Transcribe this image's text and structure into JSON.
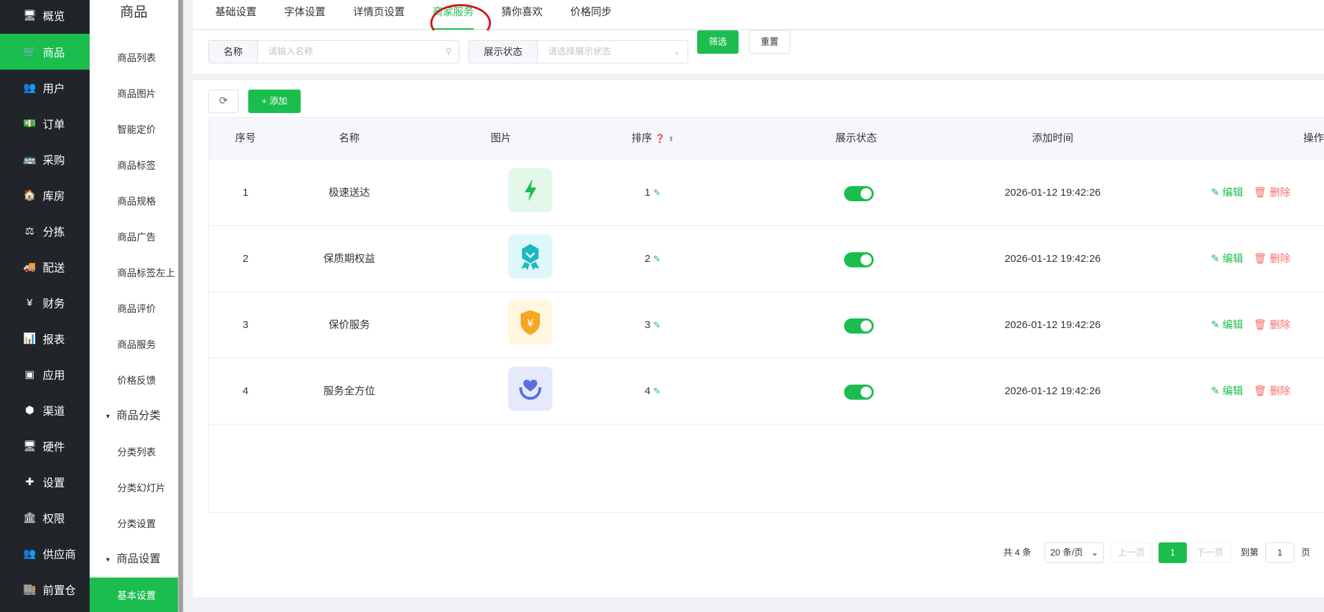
{
  "nav": {
    "items": [
      {
        "label": "概览",
        "icon": "monitor-icon",
        "glyph": "🖥"
      },
      {
        "label": "商品",
        "icon": "cart-icon",
        "glyph": "🛒"
      },
      {
        "label": "用户",
        "icon": "users-icon",
        "glyph": "👥"
      },
      {
        "label": "订单",
        "icon": "money-icon",
        "glyph": "💵"
      },
      {
        "label": "采购",
        "icon": "bus-icon",
        "glyph": "🚌"
      },
      {
        "label": "库房",
        "icon": "home-icon",
        "glyph": "🏠"
      },
      {
        "label": "分拣",
        "icon": "scale-icon",
        "glyph": "⚖"
      },
      {
        "label": "配送",
        "icon": "truck-icon",
        "glyph": "🚚"
      },
      {
        "label": "财务",
        "icon": "yen-icon",
        "glyph": "¥"
      },
      {
        "label": "报表",
        "icon": "bar-chart-icon",
        "glyph": "📊"
      },
      {
        "label": "应用",
        "icon": "apps-icon",
        "glyph": "▣"
      },
      {
        "label": "渠道",
        "icon": "cube-icon",
        "glyph": "⬢"
      },
      {
        "label": "硬件",
        "icon": "desktop-icon",
        "glyph": "🖥"
      },
      {
        "label": "设置",
        "icon": "puzzle-icon",
        "glyph": "✚"
      },
      {
        "label": "权限",
        "icon": "bank-icon",
        "glyph": "🏛"
      },
      {
        "label": "供应商",
        "icon": "users-icon",
        "glyph": "👥"
      },
      {
        "label": "前置仓",
        "icon": "warehouse-icon",
        "glyph": "🏬"
      }
    ]
  },
  "submenu": {
    "title": "商品",
    "items": [
      "商品列表",
      "商品图片",
      "智能定价",
      "商品标签",
      "商品规格",
      "商品广告",
      "商品标签左上",
      "商品评价",
      "商品服务",
      "价格反馈"
    ],
    "group1": "商品分类",
    "group1_items": [
      "分类列表",
      "分类幻灯片",
      "分类设置"
    ],
    "group2": "商品设置",
    "group2_items": [
      "基本设置"
    ]
  },
  "tabs": [
    "基础设置",
    "字体设置",
    "详情页设置",
    "商家服务",
    "猜你喜欢",
    "价格同步"
  ],
  "filter": {
    "name_label": "名称",
    "name_placeholder": "请输入名称",
    "status_label": "展示状态",
    "status_placeholder": "请选择展示状态",
    "filter_btn": "筛选",
    "reset_btn": "重置"
  },
  "toolbar": {
    "add_label": "添加"
  },
  "table": {
    "headers": [
      "序号",
      "名称",
      "图片",
      "排序",
      "展示状态",
      "添加时间",
      "操作"
    ],
    "rows": [
      {
        "no": "1",
        "name": "极速送达",
        "sort": "1",
        "time": "2026-01-12 19:42:26",
        "icon": "lightning-icon",
        "bg": "#e3f8ea",
        "color": "#1cbd4f"
      },
      {
        "no": "2",
        "name": "保质期权益",
        "sort": "2",
        "time": "2026-01-12 19:42:26",
        "icon": "badge-icon",
        "bg": "#dff7f8",
        "color": "#1bb8c2"
      },
      {
        "no": "3",
        "name": "保价服务",
        "sort": "3",
        "time": "2026-01-12 19:42:26",
        "icon": "yen-shield-icon",
        "bg": "#fff6dd",
        "color": "#f5a623"
      },
      {
        "no": "4",
        "name": "服务全方位",
        "sort": "4",
        "time": "2026-01-12 19:42:26",
        "icon": "heart-hands-icon",
        "bg": "#e6e8fb",
        "color": "#5b6ee1"
      }
    ],
    "edit_label": "编辑",
    "delete_label": "删除"
  },
  "pagination": {
    "total": "共 4 条",
    "page_size": "20 条/页",
    "prev": "上一页",
    "current": "1",
    "next": "下一页",
    "goto": "到第",
    "goto_value": "1",
    "page_unit": "页"
  },
  "colors": {
    "accent": "#1cbd4f",
    "danger": "#f56c6c",
    "nav_bg": "#212529"
  }
}
